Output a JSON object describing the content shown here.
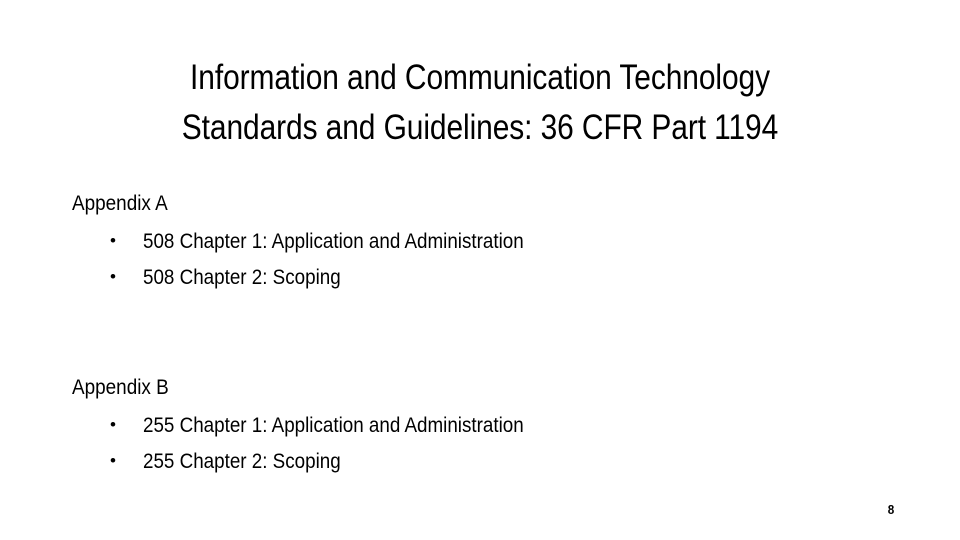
{
  "slide": {
    "title_lines": [
      "Information and Communication Technology",
      "Standards and Guidelines:  36 CFR Part 1194"
    ],
    "sections": [
      {
        "heading": "Appendix A",
        "bullets": [
          "508 Chapter 1:  Application and Administration",
          "508 Chapter 2:  Scoping"
        ]
      },
      {
        "heading": "Appendix B",
        "bullets": [
          "255 Chapter 1:  Application and Administration",
          "255 Chapter 2:  Scoping"
        ]
      }
    ],
    "bullet_glyph": "•",
    "page_number": "8",
    "colors": {
      "background": "#ffffff",
      "text": "#000000"
    }
  }
}
